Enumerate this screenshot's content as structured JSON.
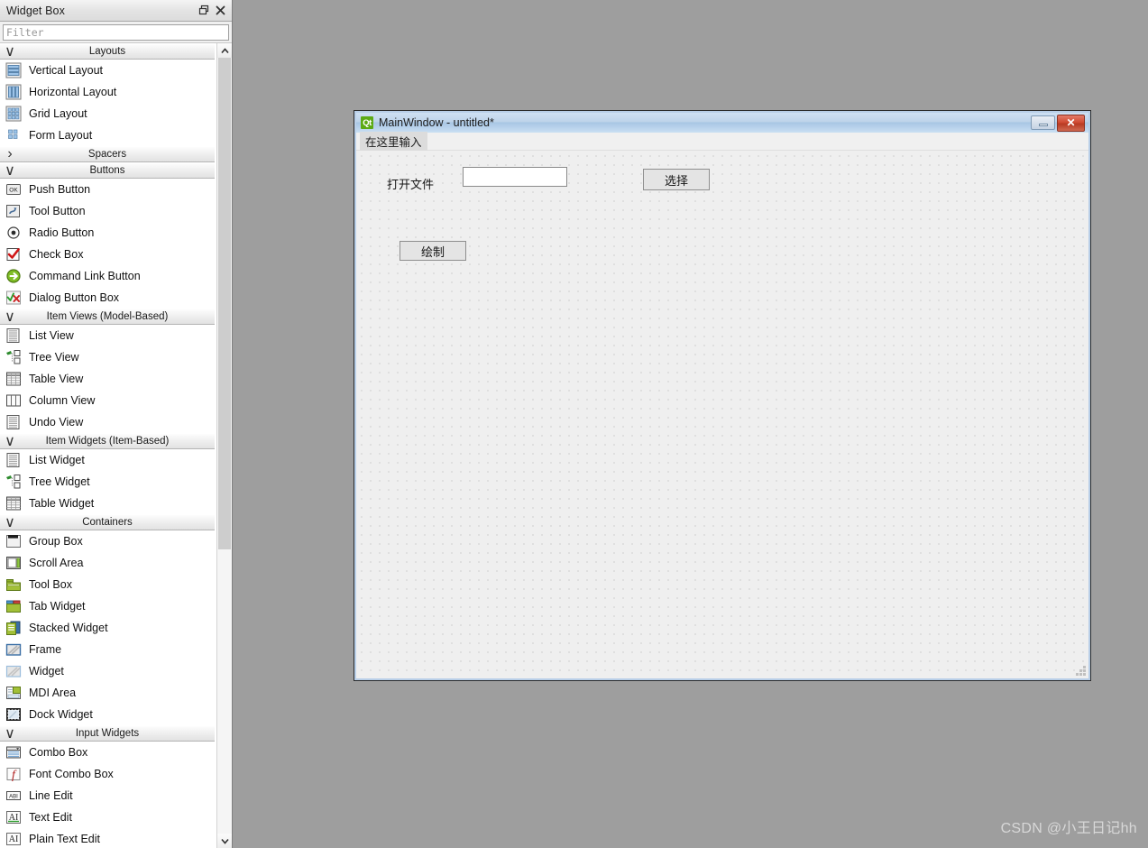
{
  "widget_box": {
    "title": "Widget Box",
    "titlebar_buttons": [
      {
        "name": "float-icon",
        "label": "Float"
      },
      {
        "name": "close-icon",
        "label": "Close"
      }
    ],
    "filter": {
      "value": "",
      "placeholder": "Filter"
    },
    "scrollbar": {
      "up_arrow": "∧",
      "down_arrow": "∨"
    },
    "groups": [
      {
        "label": "Layouts",
        "expanded": true,
        "arrow": "∨",
        "items": [
          {
            "label": "Vertical Layout",
            "icon": "vertical-layout-icon"
          },
          {
            "label": "Horizontal Layout",
            "icon": "horizontal-layout-icon"
          },
          {
            "label": "Grid Layout",
            "icon": "grid-layout-icon"
          },
          {
            "label": "Form Layout",
            "icon": "form-layout-icon"
          }
        ]
      },
      {
        "label": "Spacers",
        "expanded": false,
        "arrow": "›",
        "items": []
      },
      {
        "label": "Buttons",
        "expanded": true,
        "arrow": "∨",
        "items": [
          {
            "label": "Push Button",
            "icon": "push-button-icon"
          },
          {
            "label": "Tool Button",
            "icon": "tool-button-icon"
          },
          {
            "label": "Radio Button",
            "icon": "radio-button-icon"
          },
          {
            "label": "Check Box",
            "icon": "check-box-icon"
          },
          {
            "label": "Command Link Button",
            "icon": "command-link-button-icon"
          },
          {
            "label": "Dialog Button Box",
            "icon": "dialog-button-box-icon"
          }
        ]
      },
      {
        "label": "Item Views (Model-Based)",
        "expanded": true,
        "arrow": "∨",
        "items": [
          {
            "label": "List View",
            "icon": "list-view-icon"
          },
          {
            "label": "Tree View",
            "icon": "tree-view-icon"
          },
          {
            "label": "Table View",
            "icon": "table-view-icon"
          },
          {
            "label": "Column View",
            "icon": "column-view-icon"
          },
          {
            "label": "Undo View",
            "icon": "undo-view-icon"
          }
        ]
      },
      {
        "label": "Item Widgets (Item-Based)",
        "expanded": true,
        "arrow": "∨",
        "items": [
          {
            "label": "List Widget",
            "icon": "list-widget-icon"
          },
          {
            "label": "Tree Widget",
            "icon": "tree-widget-icon"
          },
          {
            "label": "Table Widget",
            "icon": "table-widget-icon"
          }
        ]
      },
      {
        "label": "Containers",
        "expanded": true,
        "arrow": "∨",
        "items": [
          {
            "label": "Group Box",
            "icon": "group-box-icon"
          },
          {
            "label": "Scroll Area",
            "icon": "scroll-area-icon"
          },
          {
            "label": "Tool Box",
            "icon": "tool-box-icon"
          },
          {
            "label": "Tab Widget",
            "icon": "tab-widget-icon"
          },
          {
            "label": "Stacked Widget",
            "icon": "stacked-widget-icon"
          },
          {
            "label": "Frame",
            "icon": "frame-icon"
          },
          {
            "label": "Widget",
            "icon": "widget-icon"
          },
          {
            "label": "MDI Area",
            "icon": "mdi-area-icon"
          },
          {
            "label": "Dock Widget",
            "icon": "dock-widget-icon"
          }
        ]
      },
      {
        "label": "Input Widgets",
        "expanded": true,
        "arrow": "∨",
        "items": [
          {
            "label": "Combo Box",
            "icon": "combo-box-icon"
          },
          {
            "label": "Font Combo Box",
            "icon": "font-combo-box-icon"
          },
          {
            "label": "Line Edit",
            "icon": "line-edit-icon"
          },
          {
            "label": "Text Edit",
            "icon": "text-edit-icon"
          },
          {
            "label": "Plain Text Edit",
            "icon": "plain-text-edit-icon"
          }
        ]
      }
    ]
  },
  "design_window": {
    "title": "MainWindow - untitled*",
    "logo_text": "Qt",
    "minimize_label": "Minimize",
    "close_label": "✕",
    "menubar_placeholder": "在这里输入",
    "form": {
      "label_open_file": "打开文件",
      "lineedit_value": "",
      "button_select": "选择",
      "button_draw": "绘制"
    }
  },
  "watermark": "CSDN @小王日记hh",
  "colors": {
    "desktop_background": "#9e9e9e",
    "panel_background": "#f0f0f0",
    "qt_green": "#5caa15",
    "close_red": "#c0392b",
    "window_frame_blue": "#b9cfe8",
    "canvas": "#efefef"
  }
}
